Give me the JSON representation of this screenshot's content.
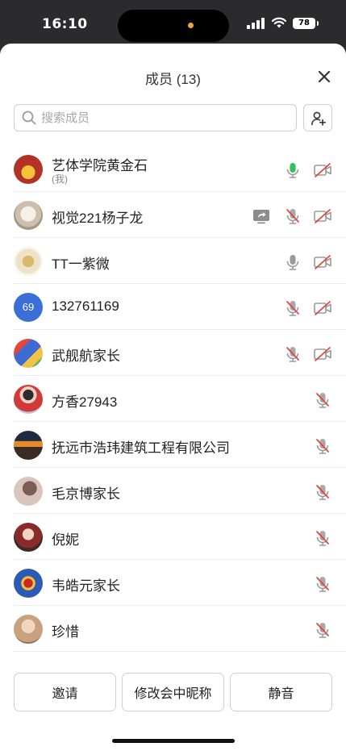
{
  "status": {
    "time": "16:10",
    "battery": "78"
  },
  "header": {
    "title": "成员 (13)"
  },
  "search": {
    "placeholder": "搜索成员"
  },
  "members": [
    {
      "name": "艺体学院黄金石",
      "sub": "(我)",
      "mic": "on",
      "cam": "off",
      "avatar": "photo"
    },
    {
      "name": "视觉221杨子龙",
      "mic": "off",
      "cam": "off",
      "share": true,
      "avatar": "photo"
    },
    {
      "name": "TT一紫微",
      "mic": "plain",
      "cam": "off",
      "avatar": "photo"
    },
    {
      "name": "132761169",
      "mic": "off",
      "cam": "off",
      "avatar": "text",
      "avatar_text": "69"
    },
    {
      "name": "武舰航家长",
      "mic": "off",
      "cam": "off",
      "avatar": "photo"
    },
    {
      "name": "方香27943",
      "mic": "off",
      "avatar": "photo"
    },
    {
      "name": "抚远市浩玮建筑工程有限公司",
      "mic": "off",
      "avatar": "photo"
    },
    {
      "name": "毛京博家长",
      "mic": "off",
      "avatar": "photo"
    },
    {
      "name": "倪妮",
      "mic": "off",
      "avatar": "photo"
    },
    {
      "name": "韦皓元家长",
      "mic": "off",
      "avatar": "photo"
    },
    {
      "name": "珍惜",
      "mic": "off",
      "avatar": "photo"
    }
  ],
  "actions": {
    "invite": "邀请",
    "rename": "修改会中昵称",
    "mute": "静音"
  },
  "colors": {
    "mic_active": "#2fc25b",
    "muted_slash": "#e0443e",
    "avatar_blue": "#3a6fd8"
  }
}
